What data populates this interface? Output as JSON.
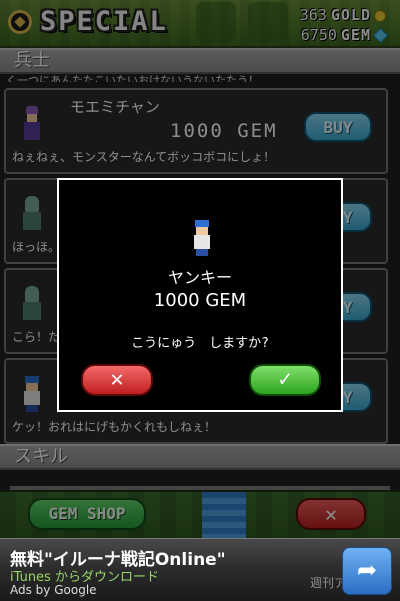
{
  "header": {
    "title": "SPECIAL",
    "gold_amount": "363",
    "gold_unit": "GOLD",
    "gem_amount": "6750",
    "gem_unit": "GEM"
  },
  "sections": {
    "soldiers_title": "兵士",
    "skills_title": "スキル"
  },
  "top_cut_line": "く一つにあんたたこいたいおけないうないたたう！",
  "items": [
    {
      "name": "モエミチャン",
      "price": "1000 GEM",
      "buy_label": "BUY",
      "desc": "ねぇねぇ、モンスターなんてボッコボコにしょ！"
    },
    {
      "name": "",
      "price": "",
      "buy_label": "BUY",
      "desc": "ほっほ。"
    },
    {
      "name": "",
      "price": "",
      "buy_label": "BUY",
      "desc": "こら！た"
    },
    {
      "name": "",
      "price": "",
      "buy_label": "BUY",
      "desc": "ケッ！おれはにげもかくれもしねぇ！"
    }
  ],
  "bottom": {
    "gem_shop_label": "GEM SHOP",
    "close_label": "✕"
  },
  "modal": {
    "name": "ヤンキー",
    "price": "1000 GEM",
    "question": "こうにゅう　しますか?",
    "cancel_label": "✕",
    "confirm_label": "✓"
  },
  "ad": {
    "title": "無料\"イルーナ戦記Online\"",
    "subtitle": "iTunes からダウンロード",
    "by": "Ads by Google",
    "watermark": "週刊ア",
    "arrow_icon": "share-arrow-icon"
  },
  "colors": {
    "buy_blue": "#3aa7cf",
    "confirm_green": "#2da320",
    "cancel_red": "#c01e1e",
    "gold": "#e8c836",
    "gem": "#54c8f0"
  }
}
